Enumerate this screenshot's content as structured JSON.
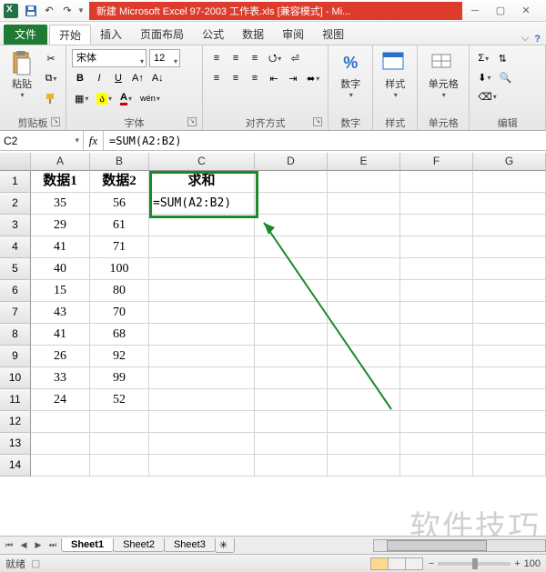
{
  "title": "新建 Microsoft Excel 97-2003 工作表.xls  [兼容模式]  -  Mi...",
  "ribbon": {
    "file": "文件",
    "tabs": [
      "开始",
      "插入",
      "页面布局",
      "公式",
      "数据",
      "审阅",
      "视图"
    ],
    "groups": {
      "clipboard": {
        "paste": "粘贴",
        "label": "剪贴板"
      },
      "font": {
        "name": "宋体",
        "size": "12",
        "label": "字体",
        "bold": "B",
        "italic": "I",
        "underline": "U"
      },
      "align": {
        "label": "对齐方式"
      },
      "number": {
        "big": "数字",
        "label": "数字"
      },
      "styles": {
        "big": "样式",
        "label": "样式"
      },
      "cells": {
        "big": "单元格",
        "label": "单元格"
      },
      "editing": {
        "label": "编辑"
      }
    }
  },
  "namebox": "C2",
  "formula": "=SUM(A2:B2)",
  "columns": [
    "A",
    "B",
    "C",
    "D",
    "E",
    "F",
    "G"
  ],
  "rows": [
    {
      "n": "1",
      "a": "数据1",
      "b": "数据2",
      "c": "求和",
      "cclass": ""
    },
    {
      "n": "2",
      "a": "35",
      "b": "56",
      "c": "=SUM(A2:B2)",
      "cclass": "formula"
    },
    {
      "n": "3",
      "a": "29",
      "b": "61",
      "c": "",
      "cclass": ""
    },
    {
      "n": "4",
      "a": "41",
      "b": "71",
      "c": "",
      "cclass": ""
    },
    {
      "n": "5",
      "a": "40",
      "b": "100",
      "c": "",
      "cclass": ""
    },
    {
      "n": "6",
      "a": "15",
      "b": "80",
      "c": "",
      "cclass": ""
    },
    {
      "n": "7",
      "a": "43",
      "b": "70",
      "c": "",
      "cclass": ""
    },
    {
      "n": "8",
      "a": "41",
      "b": "68",
      "c": "",
      "cclass": ""
    },
    {
      "n": "9",
      "a": "26",
      "b": "92",
      "c": "",
      "cclass": ""
    },
    {
      "n": "10",
      "a": "33",
      "b": "99",
      "c": "",
      "cclass": ""
    },
    {
      "n": "11",
      "a": "24",
      "b": "52",
      "c": "",
      "cclass": ""
    },
    {
      "n": "12",
      "a": "",
      "b": "",
      "c": "",
      "cclass": ""
    },
    {
      "n": "13",
      "a": "",
      "b": "",
      "c": "",
      "cclass": ""
    },
    {
      "n": "14",
      "a": "",
      "b": "",
      "c": "",
      "cclass": ""
    }
  ],
  "sheets": [
    "Sheet1",
    "Sheet2",
    "Sheet3"
  ],
  "status": "就绪",
  "zoom": "100",
  "watermark": "软件技巧",
  "chart_data": {
    "type": "table",
    "columns": [
      "数据1",
      "数据2",
      "求和"
    ],
    "rows": [
      [
        35,
        56,
        "=SUM(A2:B2)"
      ],
      [
        29,
        61,
        null
      ],
      [
        41,
        71,
        null
      ],
      [
        40,
        100,
        null
      ],
      [
        15,
        80,
        null
      ],
      [
        43,
        70,
        null
      ],
      [
        41,
        68,
        null
      ],
      [
        26,
        92,
        null
      ],
      [
        33,
        99,
        null
      ],
      [
        24,
        52,
        null
      ]
    ]
  }
}
